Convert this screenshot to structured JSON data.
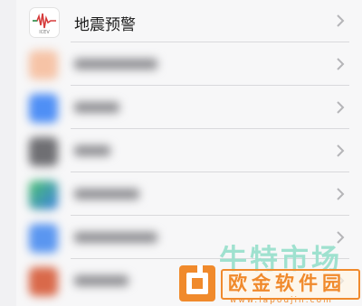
{
  "settings": {
    "first_item": {
      "label": "地震预警",
      "icon": "earthquake-warning-icon"
    },
    "blurred_items": [
      {
        "icon": "orange-app-icon",
        "color": "#f4b08a"
      },
      {
        "icon": "blue-app-icon",
        "color": "#4f8ff5"
      },
      {
        "icon": "gray-app-icon",
        "color": "#7b7b7f"
      },
      {
        "icon": "green-app-icon",
        "color": "#4cc26e"
      },
      {
        "icon": "blue-app-icon-2",
        "color": "#5a96f0"
      },
      {
        "icon": "red-app-icon",
        "color": "#d9694a"
      }
    ]
  },
  "watermark": {
    "top_text": "牛特市场",
    "brand_text": "欧金软件园",
    "url_text": "www.lapoujin.com",
    "brand_color": "#f08a2c",
    "top_color": "#9fe1cf"
  }
}
